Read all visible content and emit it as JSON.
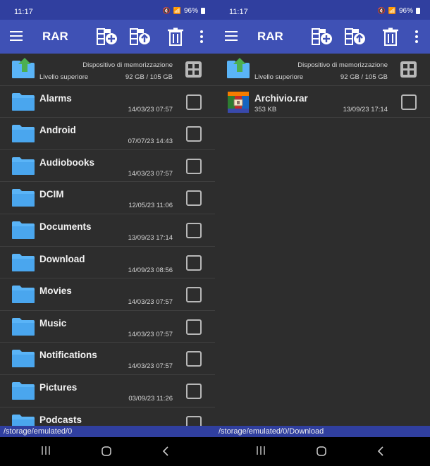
{
  "left": {
    "status": {
      "time": "11:17",
      "battery": "96%"
    },
    "toolbar": {
      "title": "RAR"
    },
    "parent": {
      "storage_label": "Dispositivo di memorizzazione",
      "label": "Livello superiore",
      "size": "92 GB / 105 GB"
    },
    "items": [
      {
        "name": "Alarms",
        "date": "14/03/23 07:57"
      },
      {
        "name": "Android",
        "date": "07/07/23 14:43"
      },
      {
        "name": "Audiobooks",
        "date": "14/03/23 07:57"
      },
      {
        "name": "DCIM",
        "date": "12/05/23 11:06"
      },
      {
        "name": "Documents",
        "date": "13/09/23 17:14"
      },
      {
        "name": "Download",
        "date": "14/09/23 08:56"
      },
      {
        "name": "Movies",
        "date": "14/03/23 07:57"
      },
      {
        "name": "Music",
        "date": "14/03/23 07:57"
      },
      {
        "name": "Notifications",
        "date": "14/03/23 07:57"
      },
      {
        "name": "Pictures",
        "date": "03/09/23 11:26"
      },
      {
        "name": "Podcasts",
        "date": ""
      }
    ],
    "path": "/storage/emulated/0"
  },
  "right": {
    "status": {
      "time": "11:17",
      "battery": "96%"
    },
    "toolbar": {
      "title": "RAR"
    },
    "parent": {
      "storage_label": "Dispositivo di memorizzazione",
      "label": "Livello superiore",
      "size": "92 GB / 105 GB"
    },
    "items": [
      {
        "name": "Archivio.rar",
        "size": "353 KB",
        "date": "13/09/23 17:14"
      }
    ],
    "path": "/storage/emulated/0/Download"
  },
  "colors": {
    "statusbar": "#303f9f",
    "toolbar": "#3f51b5",
    "background": "#2d2d2d",
    "folder": "#5ab4f7",
    "up_arrow": "#4caf50"
  }
}
